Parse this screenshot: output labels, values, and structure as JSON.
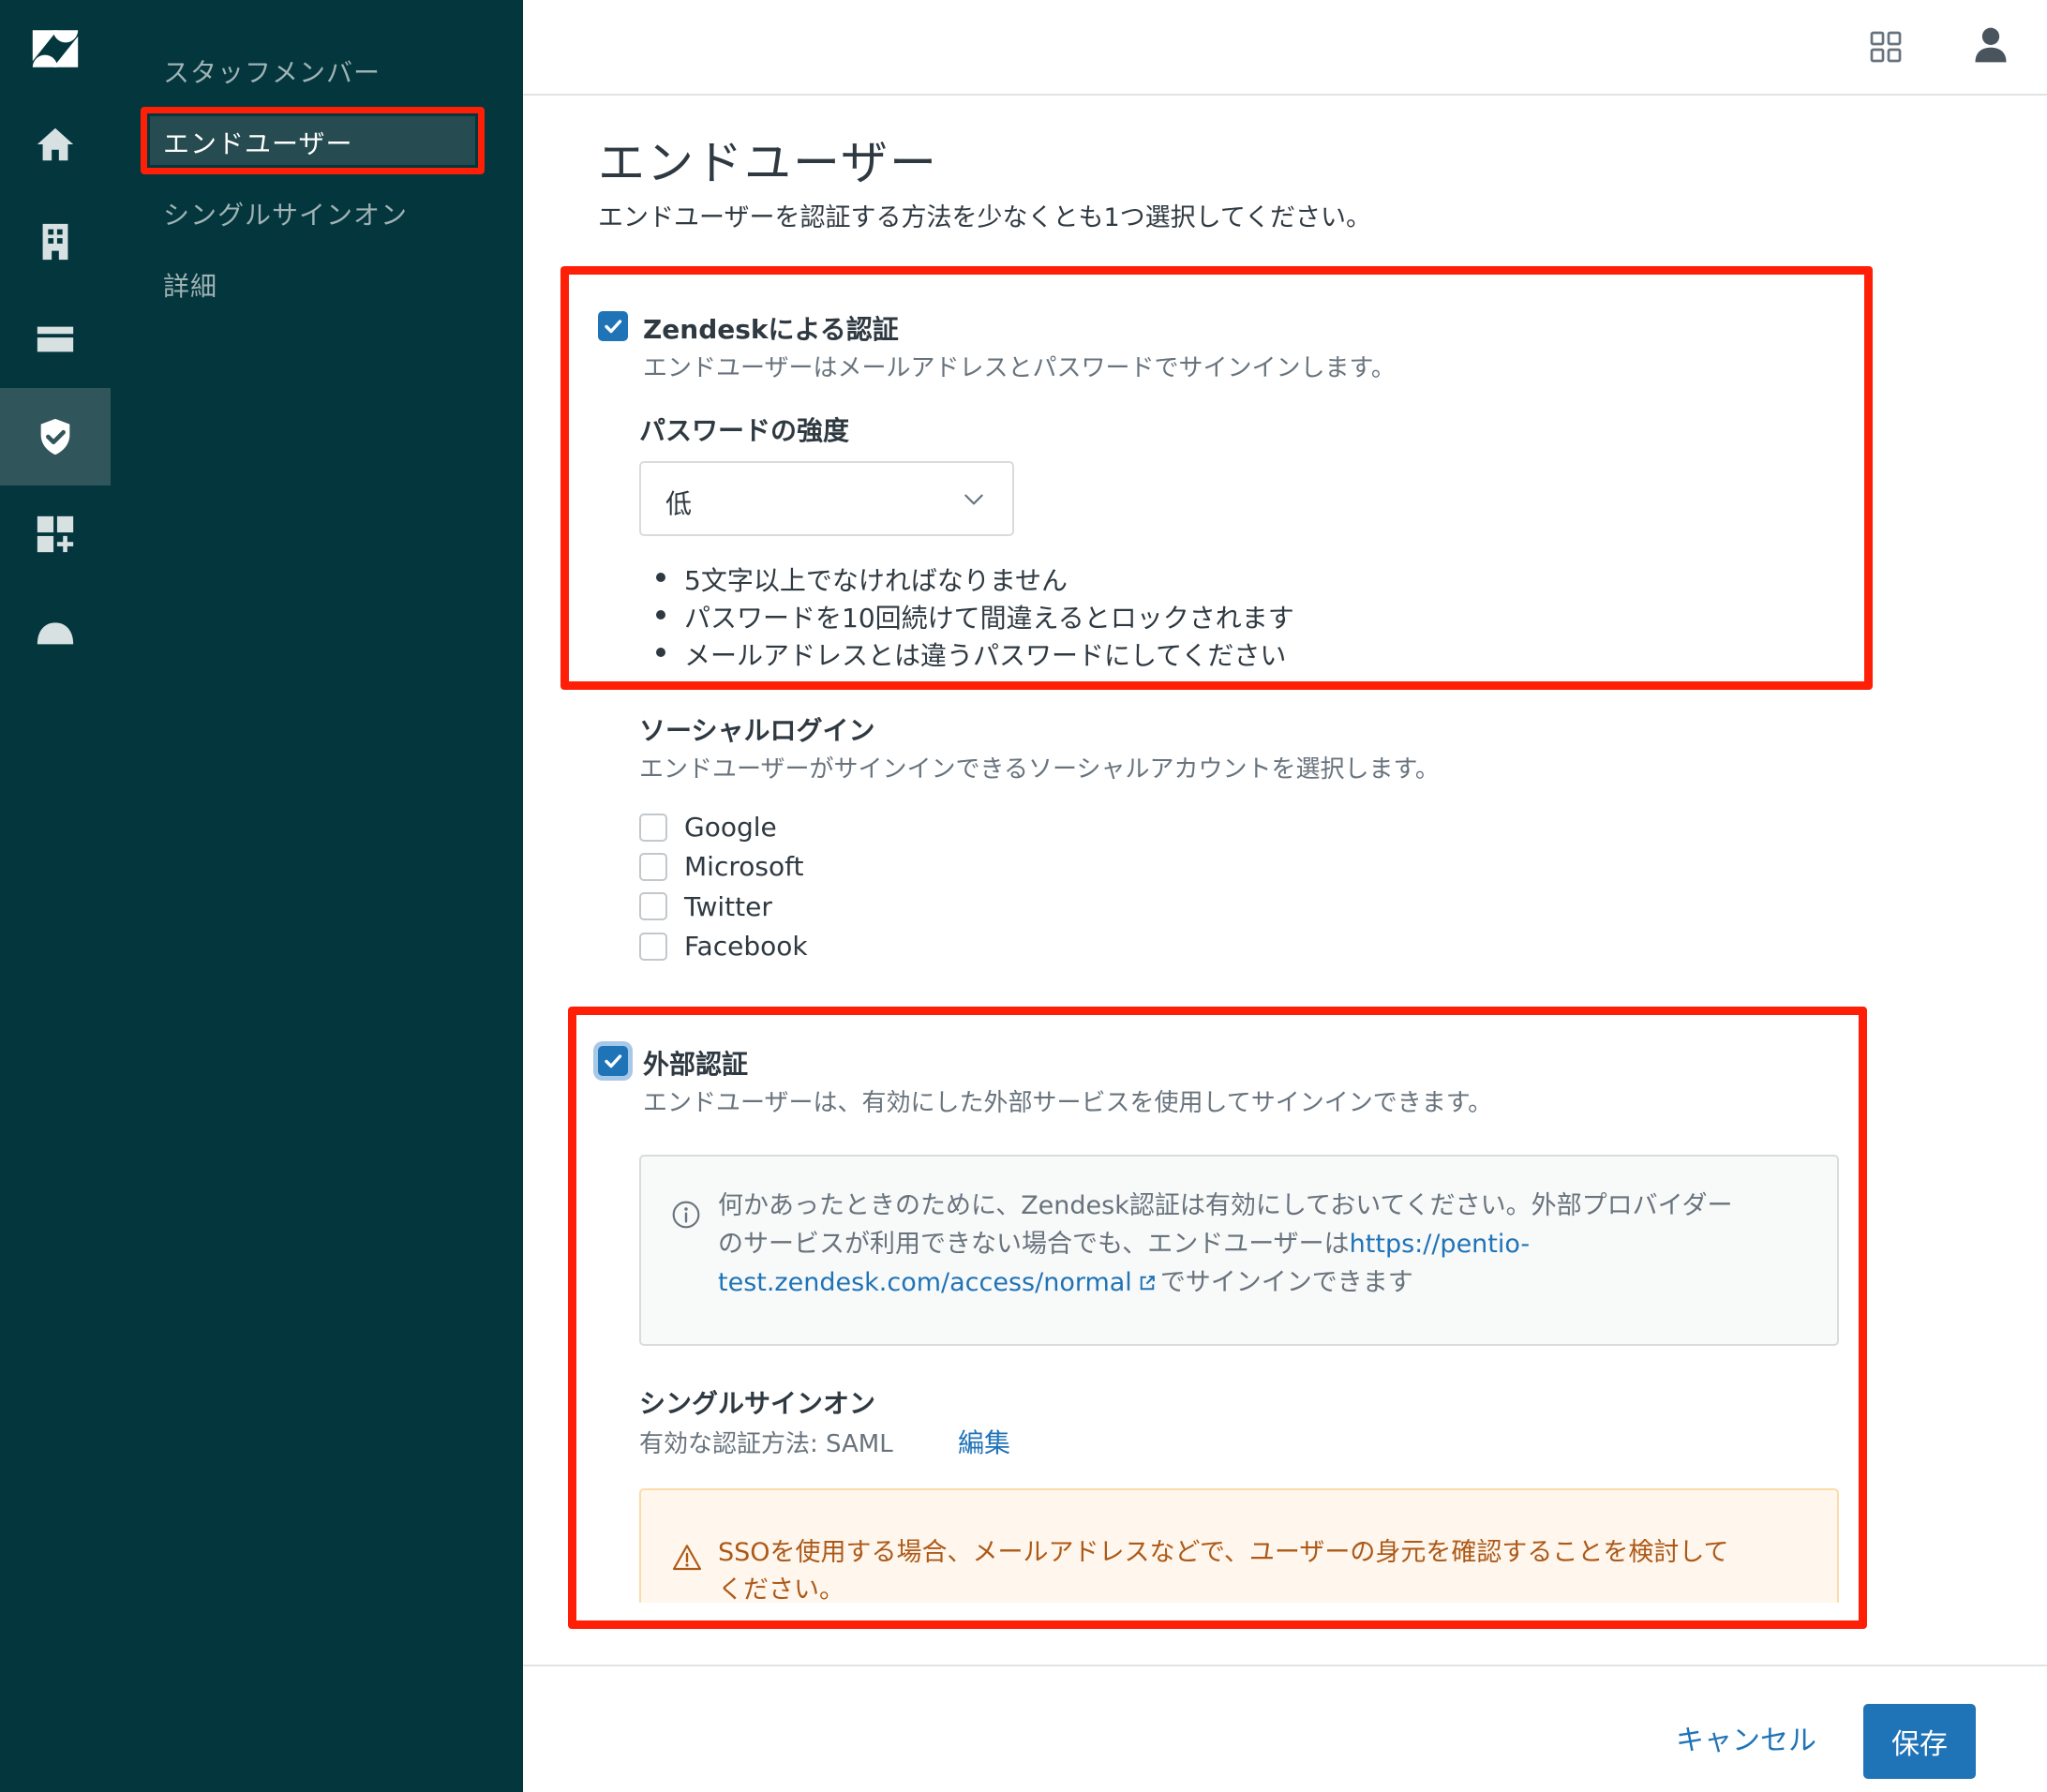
{
  "colors": {
    "sidebar_bg": "#03363d",
    "sidebar_active": "#30555a",
    "highlight_red": "#ff1f07",
    "primary_blue": "#1f73b7",
    "warning_text": "#ad5918"
  },
  "rail": {
    "items": [
      {
        "icon": "zendesk-logo-icon"
      },
      {
        "icon": "home-icon"
      },
      {
        "icon": "building-icon"
      },
      {
        "icon": "credit-card-icon"
      },
      {
        "icon": "shield-check-icon",
        "active": true
      },
      {
        "icon": "apps-add-icon"
      },
      {
        "icon": "cloud-icon"
      }
    ]
  },
  "subnav": {
    "items": [
      {
        "label": "スタッフメンバー"
      },
      {
        "label": "エンドユーザー",
        "active": true
      },
      {
        "label": "シングルサインオン"
      },
      {
        "label": "詳細"
      }
    ]
  },
  "header": {
    "apps_icon": "grid-icon",
    "user_icon": "user-icon"
  },
  "main": {
    "title": "エンドユーザー",
    "subtitle": "エンドユーザーを認証する方法を少なくとも1つ選択してください。",
    "zendesk_auth": {
      "checked": true,
      "label": "Zendeskによる認証",
      "hint": "エンドユーザーはメールアドレスとパスワードでサインインします。",
      "password_strength_label": "パスワードの強度",
      "password_strength_value": "低",
      "rules": [
        "5文字以上でなければなりません",
        "パスワードを10回続けて間違えるとロックされます",
        "メールアドレスとは違うパスワードにしてください"
      ]
    },
    "social_login": {
      "label": "ソーシャルログイン",
      "hint": "エンドユーザーがサインインできるソーシャルアカウントを選択します。",
      "options": [
        {
          "label": "Google",
          "checked": false
        },
        {
          "label": "Microsoft",
          "checked": false
        },
        {
          "label": "Twitter",
          "checked": false
        },
        {
          "label": "Facebook",
          "checked": false
        }
      ]
    },
    "external_auth": {
      "checked": true,
      "label": "外部認証",
      "hint": "エンドユーザーは、有効にした外部サービスを使用してサインインできます。",
      "info": {
        "line1": "何かあったときのために、Zendesk認証は有効にしておいてください。外部プロバイダー",
        "line2_prefix": "のサービスが利用できない場合でも、エンドユーザーは",
        "link_part1": "https://pentio-",
        "link_part2": "test.zendesk.com/access/normal",
        "line3_suffix": "でサインインできます"
      },
      "sso": {
        "label": "シングルサインオン",
        "method": "有効な認証方法: SAML",
        "edit_label": "編集"
      },
      "warning": {
        "line1": "SSOを使用する場合、メールアドレスなどで、ユーザーの身元を確認することを検討して",
        "line2": "ください。"
      }
    }
  },
  "footer": {
    "cancel_label": "キャンセル",
    "save_label": "保存"
  }
}
